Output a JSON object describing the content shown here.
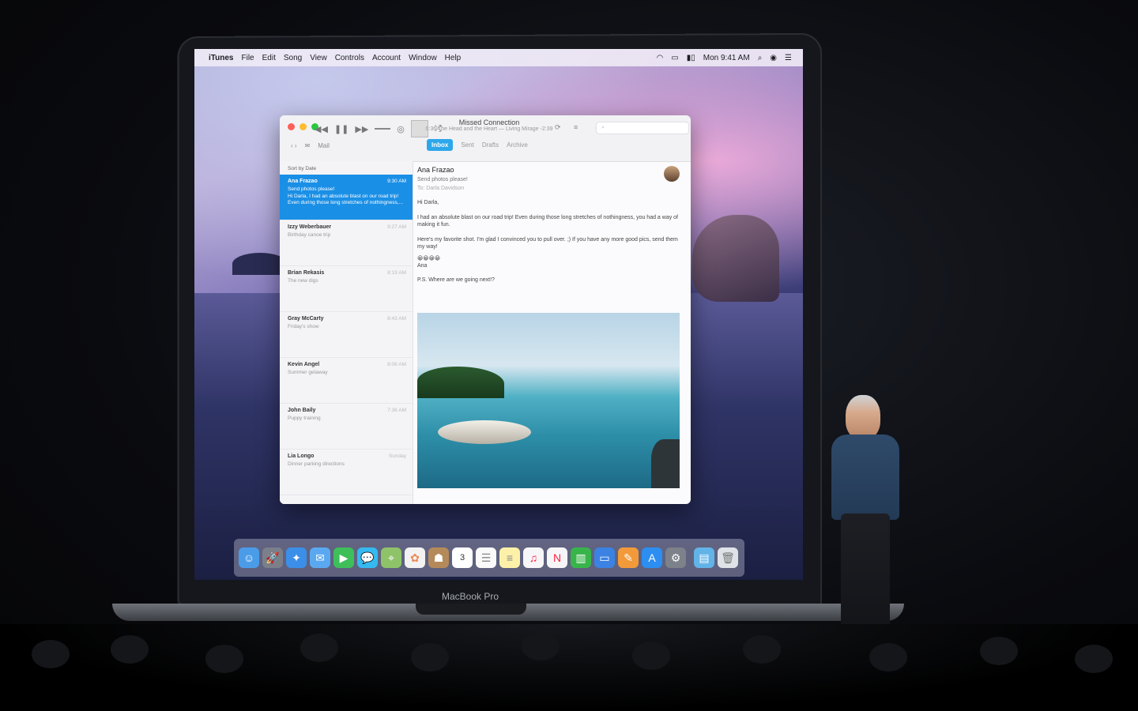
{
  "menubar": {
    "app": "iTunes",
    "items": [
      "File",
      "Edit",
      "Song",
      "View",
      "Controls",
      "Account",
      "Window",
      "Help"
    ],
    "clock": "Mon 9:41 AM"
  },
  "player": {
    "now_playing_title": "Missed Connection",
    "now_playing_sub": "The Head and the Heart — Living Mirage",
    "elapsed": "0:36",
    "remaining": "-2:39"
  },
  "mail": {
    "toolbar_label": "Mail",
    "tabs": [
      {
        "label": "Inbox",
        "active": true
      },
      {
        "label": "Sent",
        "active": false
      },
      {
        "label": "Drafts",
        "active": false
      },
      {
        "label": "Archive",
        "active": false
      }
    ],
    "sort_label": "Sort by Date",
    "messages": [
      {
        "from": "Ana Frazao",
        "time": "9:30 AM",
        "subject": "Send photos please!",
        "preview": "Hi Darla, I had an absolute blast on our road trip! Even during those long stretches of nothingness,...",
        "selected": true
      },
      {
        "from": "Izzy Weberbauer",
        "time": "9:27 AM",
        "subject": "Birthday canoe trip",
        "preview": "",
        "selected": false
      },
      {
        "from": "Brian Rekasis",
        "time": "8:19 AM",
        "subject": "The new digs",
        "preview": "",
        "selected": false
      },
      {
        "from": "Gray McCarty",
        "time": "8:43 AM",
        "subject": "Friday's show",
        "preview": "",
        "selected": false
      },
      {
        "from": "Kevin Angel",
        "time": "8:06 AM",
        "subject": "Summer getaway",
        "preview": "",
        "selected": false
      },
      {
        "from": "John Baily",
        "time": "7:36 AM",
        "subject": "Puppy training",
        "preview": "",
        "selected": false
      },
      {
        "from": "Lia Longo",
        "time": "Sunday",
        "subject": "Dinner parking directions",
        "preview": "",
        "selected": false
      }
    ],
    "reader": {
      "from": "Ana Frazao",
      "subject": "Send photos please!",
      "to": "To: Darla Davidson",
      "greeting": "Hi Darla,",
      "p1": "I had an absolute blast on our road trip! Even during those long stretches of nothingness, you had a way of making it fun.",
      "p2": "Here's my favorite shot. I'm glad I convinced you to pull over. ;) If you have any more good pics, send them my way!",
      "emoji": "😀😀😀😀",
      "signoff": "Ana",
      "ps": "P.S. Where are we going next!?"
    }
  },
  "dock": {
    "icons": [
      "finder-icon",
      "launchpad-icon",
      "safari-icon",
      "mail-icon",
      "facetime-icon",
      "messages-icon",
      "maps-icon",
      "photos-icon",
      "contacts-icon",
      "calendar-icon",
      "reminders-icon",
      "notes-icon",
      "music-icon",
      "news-icon",
      "numbers-icon",
      "keynote-icon",
      "pages-icon",
      "app-store-icon",
      "system-preferences-icon",
      "folder-icon",
      "trash-icon"
    ],
    "calendar_day": "3"
  },
  "laptop_brand": "MacBook Pro",
  "colors": {
    "selection": "#1a8fe6",
    "inbox_tab": "#2ea7ea"
  }
}
